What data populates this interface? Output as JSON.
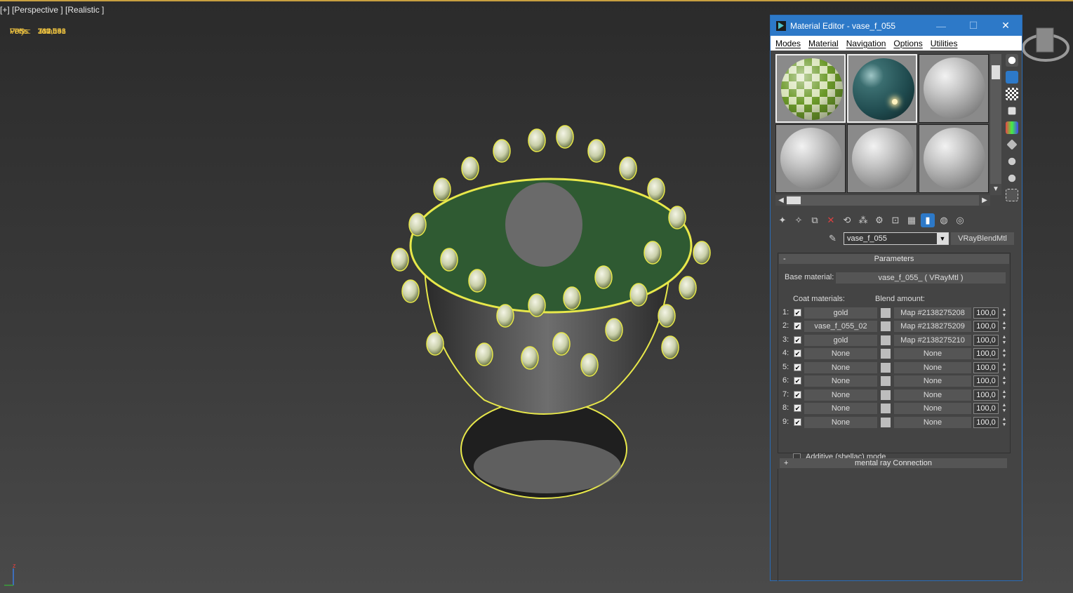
{
  "viewport": {
    "label": "[+] [Perspective ] [Realistic ]",
    "stats": {
      "header": "Total",
      "rows": [
        {
          "key": "Polys:",
          "value": "317 153"
        },
        {
          "key": "Verts:",
          "value": "332 541"
        }
      ],
      "fps_key": "FPS:",
      "fps_value": "264,096"
    },
    "axis_label": "z"
  },
  "material_editor": {
    "title": "Material Editor - vase_f_055",
    "window_buttons": {
      "minimize": "—",
      "maximize": "☐",
      "close": "✕"
    },
    "menu": [
      "Modes",
      "Material",
      "Navigation",
      "Options",
      "Utilities"
    ],
    "slots": [
      {
        "style": "checker",
        "active": true
      },
      {
        "style": "teal",
        "active": true
      },
      {
        "style": "grey",
        "active": false
      },
      {
        "style": "grey",
        "active": false
      },
      {
        "style": "grey",
        "active": false
      },
      {
        "style": "grey",
        "active": false
      }
    ],
    "material_name": "vase_f_055",
    "material_type": "VRayBlendMtl",
    "parameters": {
      "rollout_title": "Parameters",
      "rollout_sign": "-",
      "base_material_label": "Base material:",
      "base_material_value": "vase_f_055_ ( VRayMtl )",
      "coat_header": "Coat materials:",
      "blend_header": "Blend amount:",
      "rows": [
        {
          "num": "1:",
          "material": "gold",
          "map": "Map #2138275208",
          "amount": "100,0"
        },
        {
          "num": "2:",
          "material": "vase_f_055_02",
          "map": "Map #2138275209",
          "amount": "100,0"
        },
        {
          "num": "3:",
          "material": "gold",
          "map": "Map #2138275210",
          "amount": "100,0"
        },
        {
          "num": "4:",
          "material": "None",
          "map": "None",
          "amount": "100,0"
        },
        {
          "num": "5:",
          "material": "None",
          "map": "None",
          "amount": "100,0"
        },
        {
          "num": "6:",
          "material": "None",
          "map": "None",
          "amount": "100,0"
        },
        {
          "num": "7:",
          "material": "None",
          "map": "None",
          "amount": "100,0"
        },
        {
          "num": "8:",
          "material": "None",
          "map": "None",
          "amount": "100,0"
        },
        {
          "num": "9:",
          "material": "None",
          "map": "None",
          "amount": "100,0"
        }
      ],
      "additive_label": "Additive (shellac) mode"
    },
    "mental_ray": {
      "title": "mental ray Connection",
      "sign": "+"
    }
  }
}
